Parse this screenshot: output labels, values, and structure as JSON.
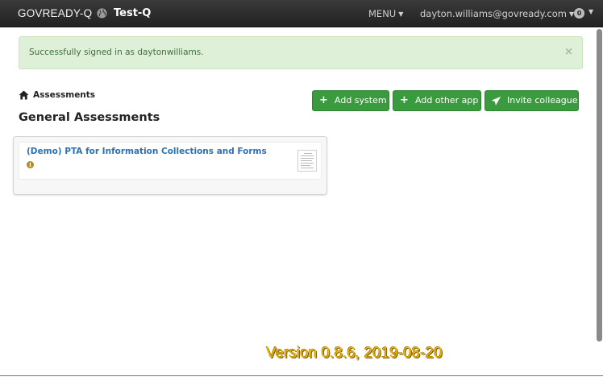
{
  "navbar": {
    "brand": "GOVREADY-Q",
    "org_name": "Test-Q",
    "menu_label": "MENU",
    "user_email": "dayton.williams@govready.com",
    "notifications_count": "0"
  },
  "alert": {
    "message": "Successfully signed in as daytonwilliams.",
    "close_symbol": "×"
  },
  "breadcrumb": {
    "label": "Assessments"
  },
  "page": {
    "title": "General Assessments"
  },
  "actions": {
    "add_system": "Add system",
    "add_other_app": "Add other app",
    "invite_colleague": "Invite colleague"
  },
  "assessments": [
    {
      "title": "(Demo) PTA for Information Collections and Forms"
    }
  ],
  "footer": {
    "version": "Version 0.8.6, 2019-08-20"
  },
  "colors": {
    "navbar_bg": "#222222",
    "alert_bg": "#dff0d8",
    "button_green": "#3a9b3e",
    "link_blue": "#2c71b3",
    "version_yellow": "#f2b600"
  },
  "icons": {
    "globe": "globe-icon",
    "home": "home-icon",
    "plus": "plus-icon",
    "send": "paper-plane-icon",
    "info": "info-icon"
  }
}
